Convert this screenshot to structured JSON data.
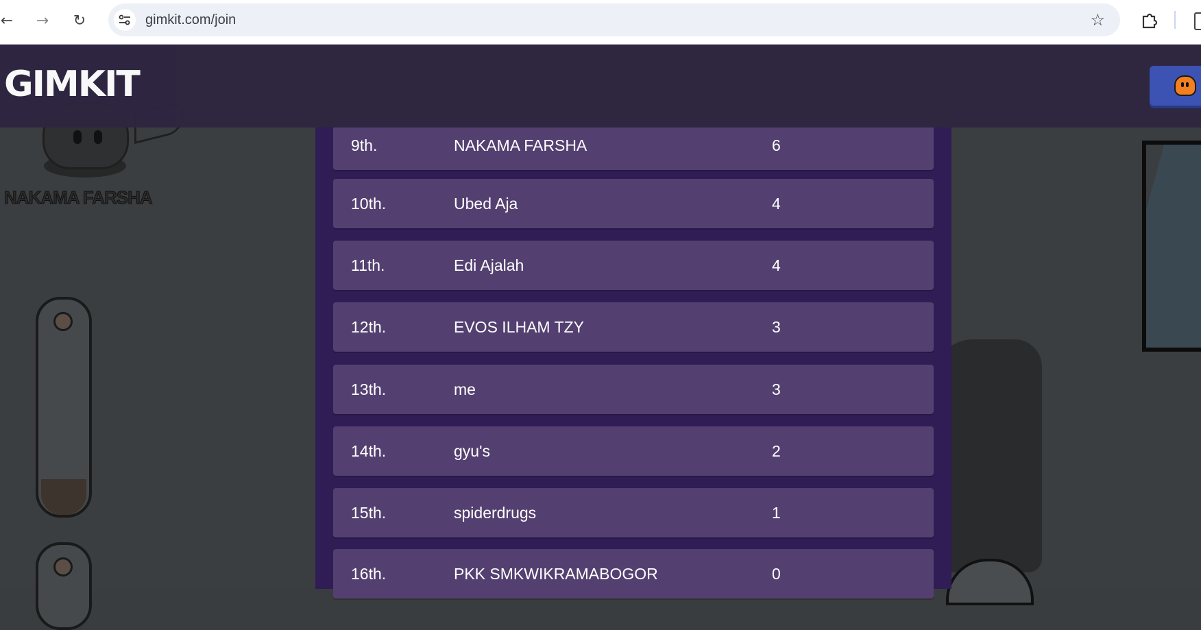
{
  "browser": {
    "url": "gimkit.com/join",
    "icons": [
      "back-arrow-icon",
      "forward-arrow-icon",
      "reload-icon",
      "site-info-icon",
      "bookmark-star-icon",
      "extensions-icon"
    ]
  },
  "header": {
    "logo": "GIMKIT"
  },
  "game": {
    "player_name": "NAKAMA FARSHA"
  },
  "leaderboard": [
    {
      "rank": "9th.",
      "name": "NAKAMA FARSHA",
      "score": "6"
    },
    {
      "rank": "10th.",
      "name": "Ubed Aja",
      "score": "4"
    },
    {
      "rank": "11th.",
      "name": "Edi Ajalah",
      "score": "4"
    },
    {
      "rank": "12th.",
      "name": "EVOS ILHAM TZY",
      "score": "3"
    },
    {
      "rank": "13th.",
      "name": "me",
      "score": "3"
    },
    {
      "rank": "14th.",
      "name": "gyu's",
      "score": "2"
    },
    {
      "rank": "15th.",
      "name": "spiderdrugs",
      "score": "1"
    },
    {
      "rank": "16th.",
      "name": "PKK SMKWIKRAMABOGOR",
      "score": "0"
    }
  ],
  "colors": {
    "header_bg": "#2e2540",
    "board_bg": "#301d55",
    "row_bg": "#534070",
    "header_button": "#3c53b3"
  }
}
